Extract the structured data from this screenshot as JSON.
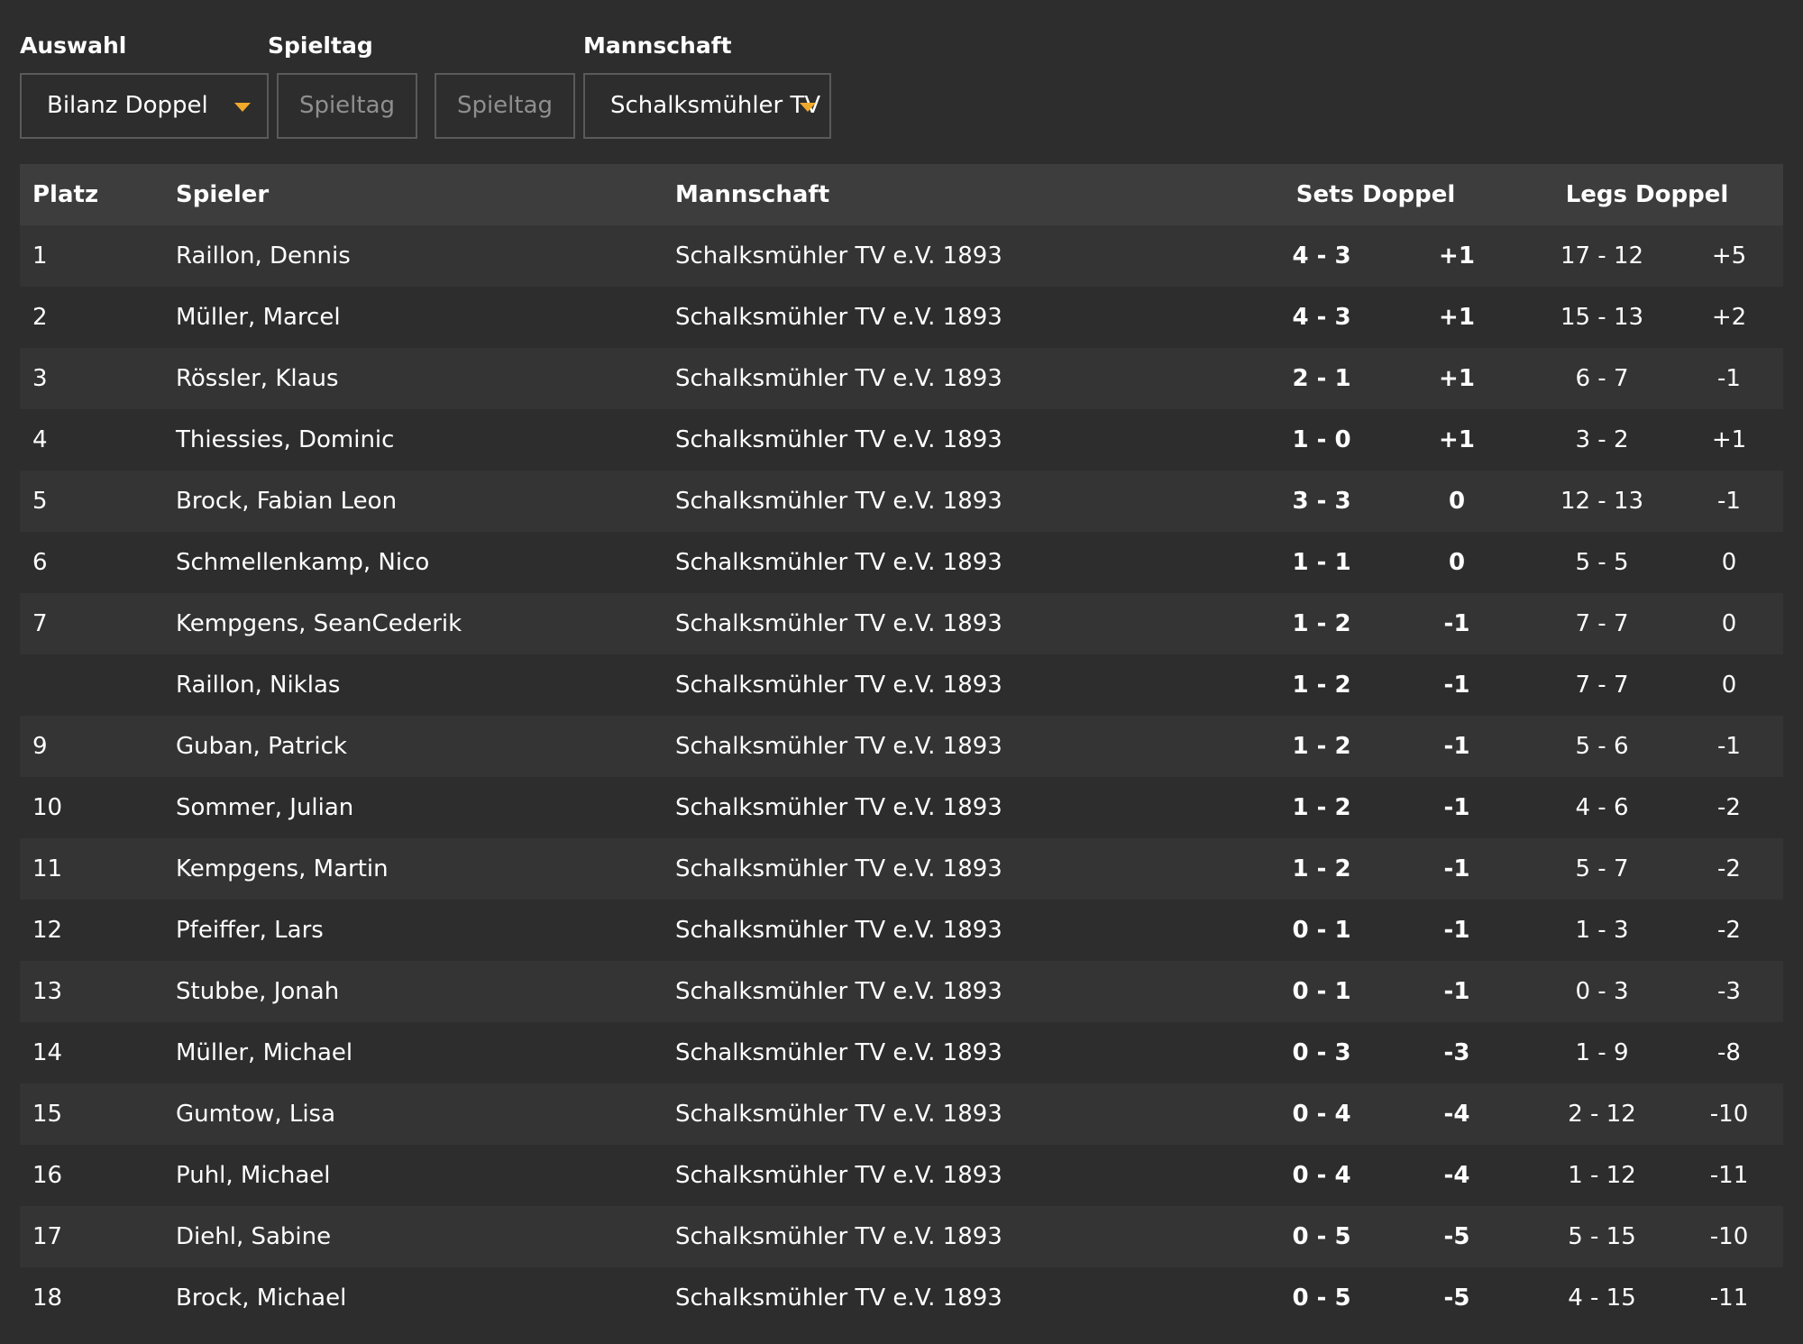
{
  "filters": {
    "auswahl_label": "Auswahl",
    "spieltag_label": "Spieltag",
    "mannschaft_label": "Mannschaft",
    "auswahl_value": "Bilanz Doppel",
    "spieltag_from_placeholder": "Spieltag",
    "spieltag_to_placeholder": "Spieltag",
    "mannschaft_value": "Schalksmühler TV"
  },
  "table": {
    "headers": {
      "rank": "Platz",
      "player": "Spieler",
      "team": "Mannschaft",
      "sets": "Sets Doppel",
      "legs": "Legs Doppel"
    },
    "rows": [
      {
        "rank": "1",
        "player": "Raillon, Dennis",
        "team": "Schalksmühler TV e.V. 1893",
        "sets": "4 - 3",
        "sets_diff": "+1",
        "legs": "17 - 12",
        "legs_diff": "+5"
      },
      {
        "rank": "2",
        "player": "Müller, Marcel",
        "team": "Schalksmühler TV e.V. 1893",
        "sets": "4 - 3",
        "sets_diff": "+1",
        "legs": "15 - 13",
        "legs_diff": "+2"
      },
      {
        "rank": "3",
        "player": "Rössler, Klaus",
        "team": "Schalksmühler TV e.V. 1893",
        "sets": "2 - 1",
        "sets_diff": "+1",
        "legs": "6 - 7",
        "legs_diff": "-1"
      },
      {
        "rank": "4",
        "player": "Thiessies, Dominic",
        "team": "Schalksmühler TV e.V. 1893",
        "sets": "1 - 0",
        "sets_diff": "+1",
        "legs": "3 - 2",
        "legs_diff": "+1"
      },
      {
        "rank": "5",
        "player": "Brock, Fabian Leon",
        "team": "Schalksmühler TV e.V. 1893",
        "sets": "3 - 3",
        "sets_diff": "0",
        "legs": "12 - 13",
        "legs_diff": "-1"
      },
      {
        "rank": "6",
        "player": "Schmellenkamp, Nico",
        "team": "Schalksmühler TV e.V. 1893",
        "sets": "1 - 1",
        "sets_diff": "0",
        "legs": "5 - 5",
        "legs_diff": "0"
      },
      {
        "rank": "7",
        "player": "Kempgens, SeanCederik",
        "team": "Schalksmühler TV e.V. 1893",
        "sets": "1 - 2",
        "sets_diff": "-1",
        "legs": "7 - 7",
        "legs_diff": "0"
      },
      {
        "rank": "",
        "player": "Raillon, Niklas",
        "team": "Schalksmühler TV e.V. 1893",
        "sets": "1 - 2",
        "sets_diff": "-1",
        "legs": "7 - 7",
        "legs_diff": "0"
      },
      {
        "rank": "9",
        "player": "Guban, Patrick",
        "team": "Schalksmühler TV e.V. 1893",
        "sets": "1 - 2",
        "sets_diff": "-1",
        "legs": "5 - 6",
        "legs_diff": "-1"
      },
      {
        "rank": "10",
        "player": "Sommer, Julian",
        "team": "Schalksmühler TV e.V. 1893",
        "sets": "1 - 2",
        "sets_diff": "-1",
        "legs": "4 - 6",
        "legs_diff": "-2"
      },
      {
        "rank": "11",
        "player": "Kempgens, Martin",
        "team": "Schalksmühler TV e.V. 1893",
        "sets": "1 - 2",
        "sets_diff": "-1",
        "legs": "5 - 7",
        "legs_diff": "-2"
      },
      {
        "rank": "12",
        "player": "Pfeiffer, Lars",
        "team": "Schalksmühler TV e.V. 1893",
        "sets": "0 - 1",
        "sets_diff": "-1",
        "legs": "1 - 3",
        "legs_diff": "-2"
      },
      {
        "rank": "13",
        "player": "Stubbe, Jonah",
        "team": "Schalksmühler TV e.V. 1893",
        "sets": "0 - 1",
        "sets_diff": "-1",
        "legs": "0 - 3",
        "legs_diff": "-3"
      },
      {
        "rank": "14",
        "player": "Müller, Michael",
        "team": "Schalksmühler TV e.V. 1893",
        "sets": "0 - 3",
        "sets_diff": "-3",
        "legs": "1 - 9",
        "legs_diff": "-8"
      },
      {
        "rank": "15",
        "player": "Gumtow, Lisa",
        "team": "Schalksmühler TV e.V. 1893",
        "sets": "0 - 4",
        "sets_diff": "-4",
        "legs": "2 - 12",
        "legs_diff": "-10"
      },
      {
        "rank": "16",
        "player": "Puhl, Michael",
        "team": "Schalksmühler TV e.V. 1893",
        "sets": "0 - 4",
        "sets_diff": "-4",
        "legs": "1 - 12",
        "legs_diff": "-11"
      },
      {
        "rank": "17",
        "player": "Diehl, Sabine",
        "team": "Schalksmühler TV e.V. 1893",
        "sets": "0 - 5",
        "sets_diff": "-5",
        "legs": "5 - 15",
        "legs_diff": "-10"
      },
      {
        "rank": "18",
        "player": "Brock, Michael",
        "team": "Schalksmühler TV e.V. 1893",
        "sets": "0 - 5",
        "sets_diff": "-5",
        "legs": "4 - 15",
        "legs_diff": "-11"
      }
    ]
  },
  "colors": {
    "background": "#2d2d2d",
    "row_alt": "#343434",
    "header_bg": "#3d3d3d",
    "accent_caret": "#f0a92b",
    "border": "#5a5a5a",
    "disabled_text": "#8f8f8f"
  },
  "icons": {
    "dropdown": "chevron-down-icon"
  }
}
